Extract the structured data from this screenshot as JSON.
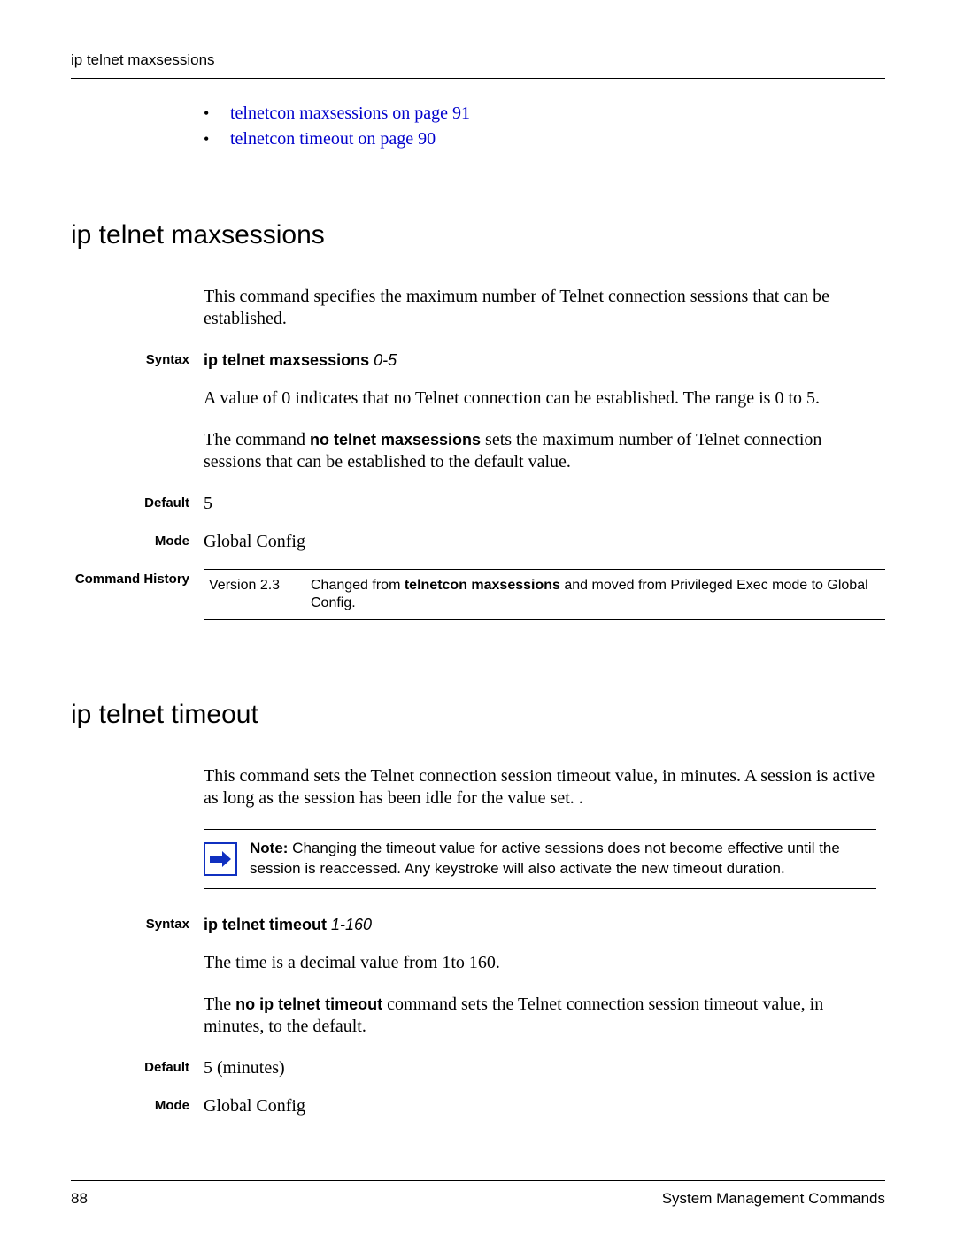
{
  "header": {
    "running_title": "ip telnet maxsessions"
  },
  "xrefs": {
    "items": [
      {
        "text": "telnetcon maxsessions on page 91"
      },
      {
        "text": "telnetcon timeout on page 90"
      }
    ]
  },
  "section1": {
    "title": "ip telnet maxsessions",
    "intro": "This command specifies the maximum number of Telnet connection sessions that can be established.",
    "syntax_label": "Syntax",
    "syntax_cmd": "ip telnet maxsessions",
    "syntax_arg": "0-5",
    "detail1": "A value of 0 indicates that no Telnet connection can be established. The range is 0 to 5.",
    "detail2_pre": "The command ",
    "detail2_cmd": "no telnet maxsessions",
    "detail2_post": " sets the maximum number of Telnet connection sessions that can be established to the default value.",
    "default_label": "Default",
    "default_value": "5",
    "mode_label": "Mode",
    "mode_value": "Global Config",
    "history_label": "Command History",
    "history_version": "Version 2.3",
    "history_desc_pre": "Changed from ",
    "history_desc_cmd": "telnetcon maxsessions",
    "history_desc_post": " and moved from Privileged Exec mode to Global Config."
  },
  "section2": {
    "title": "ip telnet timeout",
    "intro": "This command sets the Telnet connection session timeout value, in minutes. A session is active as long as the session has been idle for the value set. .",
    "note_label": "Note:",
    "note_text": " Changing the timeout value for active sessions does not become effective until the session is reaccessed. Any keystroke will also activate the new timeout duration.",
    "syntax_label": "Syntax",
    "syntax_cmd": "ip telnet timeout",
    "syntax_arg": "1-160",
    "detail1": "The time is a decimal value from 1to 160.",
    "detail2_pre": "The ",
    "detail2_cmd": "no ip telnet timeout",
    "detail2_post": " command sets the Telnet connection session timeout value, in minutes, to the default.",
    "default_label": "Default",
    "default_value": "5 (minutes)",
    "mode_label": "Mode",
    "mode_value": "Global Config"
  },
  "footer": {
    "page_number": "88",
    "chapter": "System Management Commands"
  }
}
